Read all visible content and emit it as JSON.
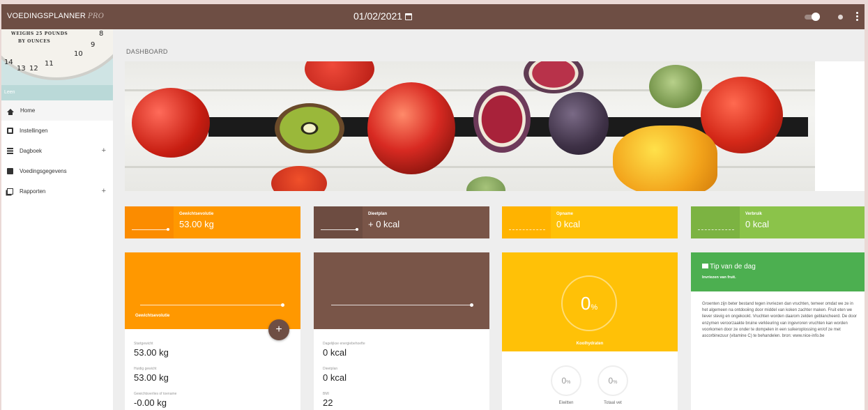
{
  "app": {
    "name": "VOEDINGSPLANNER",
    "edition": "PRO",
    "date": "01/02/2021"
  },
  "sidebar": {
    "profile": {
      "scale_text_1": "WEIGHS 25 POUNDS",
      "scale_text_2": "BY OUNCES",
      "scale_numbers": [
        "14",
        "13",
        "12",
        "11",
        "10",
        "9",
        "8"
      ],
      "name": "Leen"
    },
    "items": [
      {
        "label": "Home",
        "icon": "home-icon",
        "active": true
      },
      {
        "label": "Instellingen",
        "icon": "card-icon"
      },
      {
        "label": "Dagboek",
        "icon": "list-icon",
        "expand": "+"
      },
      {
        "label": "Voedingsgegevens",
        "icon": "phone-icon"
      },
      {
        "label": "Rapporten",
        "icon": "report-icon",
        "expand": "+"
      }
    ]
  },
  "main": {
    "title": "DASHBOARD"
  },
  "tiles": [
    {
      "label": "Gewichtsevolutie",
      "value": "53.00 kg",
      "color": "#ff9800"
    },
    {
      "label": "Dieetplan",
      "value": "+ 0 kcal",
      "color": "#795548"
    },
    {
      "label": "Opname",
      "value": "0 kcal",
      "color": "#ffc107"
    },
    {
      "label": "Verbruik",
      "value": "0 kcal",
      "color": "#8bc34a"
    }
  ],
  "cards": {
    "weight": {
      "label": "Gewichtsevolutie",
      "add_label": "+",
      "stats": [
        {
          "label": "Startgewicht",
          "value": "53.00 kg"
        },
        {
          "label": "Huidig gewicht",
          "value": "53.00 kg"
        },
        {
          "label": "Gewichtsverlies of toename",
          "value": "-0.00 kg"
        }
      ]
    },
    "diet": {
      "stats": [
        {
          "label": "Dagelijkse energiebehoefte",
          "value": "0 kcal"
        },
        {
          "label": "Dieetplan",
          "value": "0 kcal"
        },
        {
          "label": "BMI",
          "value": "22"
        }
      ]
    },
    "intake": {
      "main_value": "0",
      "main_unit": "%",
      "main_label": "Koolhydraten",
      "sub": [
        {
          "value": "0",
          "unit": "%",
          "label": "Eiwitten"
        },
        {
          "value": "0",
          "unit": "%",
          "label": "Totaal vet"
        }
      ]
    },
    "tip": {
      "title": "Tip van de dag",
      "subtitle": "Invriezen van fruit.",
      "body": "Groenten zijn beter bestand tegen invriezen dan vruchten, temeer omdat we ze in het algemeen na ontdooiing door middel van koken zachter maken. Fruit eten we liever stevig en ongekookt. Vruchten worden daarom zelden geblancheerd. De door enzymen veroorzaakte bruine verkleuring van ingevroren vruchten kan worden voorkomen door ze onder te dompelen in een suikeroplossing en/of ze met ascorbinezuur (vitamine C) te behandelen. bron: www.nice-info.be"
    }
  },
  "colors": {
    "brand": "#6e4e44",
    "orange": "#ff9800",
    "brown": "#795548",
    "amber": "#ffc107",
    "lightgreen": "#8bc34a",
    "green": "#4caf50"
  }
}
